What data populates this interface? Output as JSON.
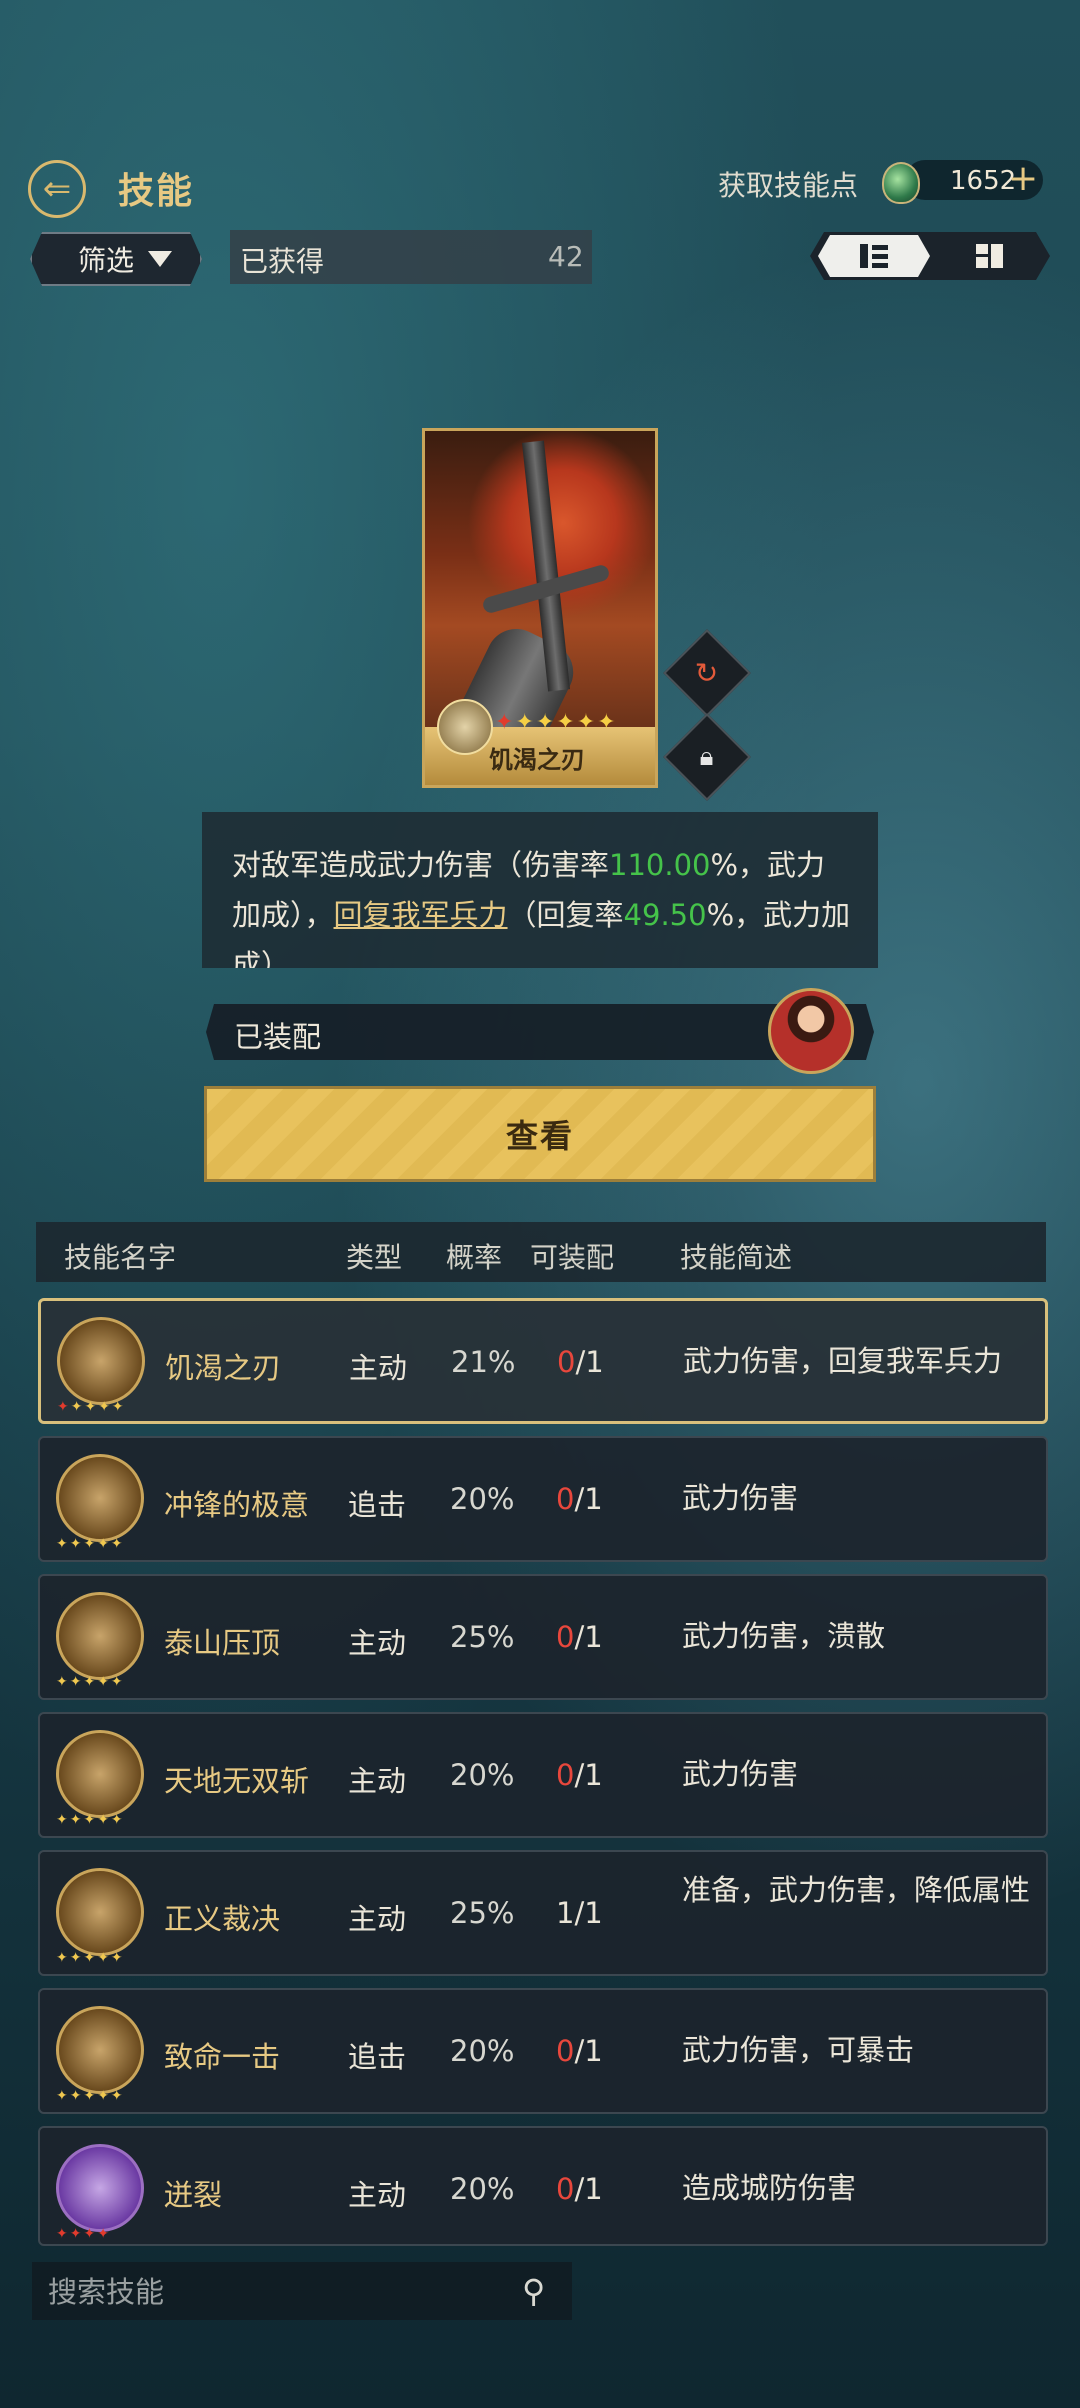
{
  "header": {
    "title": "技能",
    "skill_points_label": "获取技能点",
    "skill_points_value": "1652",
    "plus": "+"
  },
  "filter": {
    "label": "筛选",
    "obtained_label": "已获得",
    "obtained_count": "42"
  },
  "card": {
    "name": "饥渴之刃",
    "stars": "✦✦✦✦✦"
  },
  "description": {
    "part1": "对敌军造成武力伤害（伤害率",
    "rate1": "110.00",
    "part2": "%，武力加成），",
    "link": "回复我军兵力",
    "part3": "（回复率",
    "rate2": "49.50",
    "part4": "%，武力加成）"
  },
  "equipped_label": "已装配",
  "check_label": "查看",
  "table": {
    "headers": [
      "技能名字",
      "类型",
      "概率",
      "可装配",
      "技能简述"
    ],
    "rows": [
      {
        "name": "饥渴之刃",
        "type": "主动",
        "rate": "21%",
        "equip_used": "0",
        "equip_total": "/1",
        "desc": "武力伤害，回复我军兵力"
      },
      {
        "name": "冲锋的极意",
        "type": "追击",
        "rate": "20%",
        "equip_used": "0",
        "equip_total": "/1",
        "desc": "武力伤害"
      },
      {
        "name": "泰山压顶",
        "type": "主动",
        "rate": "25%",
        "equip_used": "0",
        "equip_total": "/1",
        "desc": "武力伤害，溃散"
      },
      {
        "name": "天地无双斩",
        "type": "主动",
        "rate": "20%",
        "equip_used": "0",
        "equip_total": "/1",
        "desc": "武力伤害"
      },
      {
        "name": "正义裁决",
        "type": "主动",
        "rate": "25%",
        "equip_used": "1",
        "equip_total": "/1",
        "desc": "准备，武力伤害，降低属性"
      },
      {
        "name": "致命一击",
        "type": "追击",
        "rate": "20%",
        "equip_used": "0",
        "equip_total": "/1",
        "desc": "武力伤害，可暴击"
      },
      {
        "name": "迸裂",
        "type": "主动",
        "rate": "20%",
        "equip_used": "0",
        "equip_total": "/1",
        "desc": "造成城防伤害"
      }
    ]
  },
  "search": {
    "placeholder": "搜索技能"
  },
  "colors": {
    "accent_gold": "#e7c983",
    "rate_green": "#45c34a",
    "count_red": "#e8473c"
  }
}
